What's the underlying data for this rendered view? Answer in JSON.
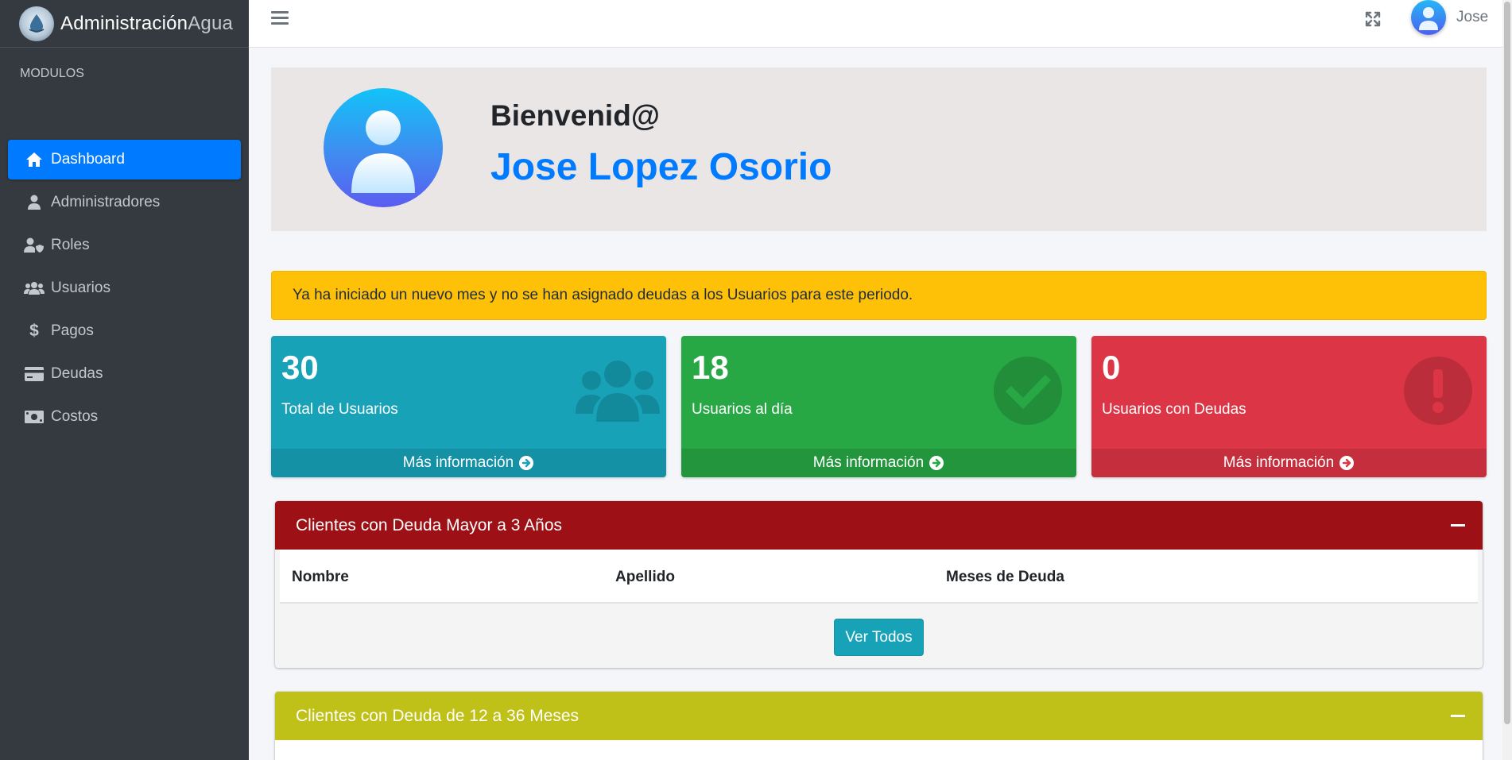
{
  "brand": {
    "name_strong": "Administración",
    "name_light": "Agua"
  },
  "sidebar": {
    "header": "MODULOS",
    "items": [
      {
        "label": "Dashboard",
        "icon": "home-icon",
        "active": true
      },
      {
        "label": "Administradores",
        "icon": "user-icon"
      },
      {
        "label": "Roles",
        "icon": "user-shield-icon"
      },
      {
        "label": "Usuarios",
        "icon": "users-icon"
      },
      {
        "label": "Pagos",
        "icon": "dollar-icon"
      },
      {
        "label": "Deudas",
        "icon": "credit-card-icon"
      },
      {
        "label": "Costos",
        "icon": "money-bill-icon"
      }
    ]
  },
  "navbar": {
    "user_name": "Jose"
  },
  "welcome": {
    "greeting": "Bienvenid@",
    "full_name": "Jose Lopez Osorio"
  },
  "alert": {
    "text": "Ya ha iniciado un nuevo mes y no se han asignado deudas a los Usuarios para este periodo."
  },
  "stats": [
    {
      "value": "30",
      "label": "Total de Usuarios",
      "link": "Más información",
      "color": "#17a2b8",
      "icon": "users-icon"
    },
    {
      "value": "18",
      "label": "Usuarios al día",
      "link": "Más información",
      "color": "#28a745",
      "icon": "check-circle-icon"
    },
    {
      "value": "0",
      "label": "Usuarios con Deudas",
      "link": "Más información",
      "color": "#dc3545",
      "icon": "exclamation-circle-icon"
    }
  ],
  "cards": [
    {
      "title": "Clientes con Deuda Mayor a 3 Años",
      "color": "#9c1016",
      "columns": [
        "Nombre",
        "Apellido",
        "Meses de Deuda"
      ],
      "button": "Ver Todos"
    },
    {
      "title": "Clientes con Deuda de 12 a 36 Meses",
      "color": "#c0c118"
    }
  ]
}
